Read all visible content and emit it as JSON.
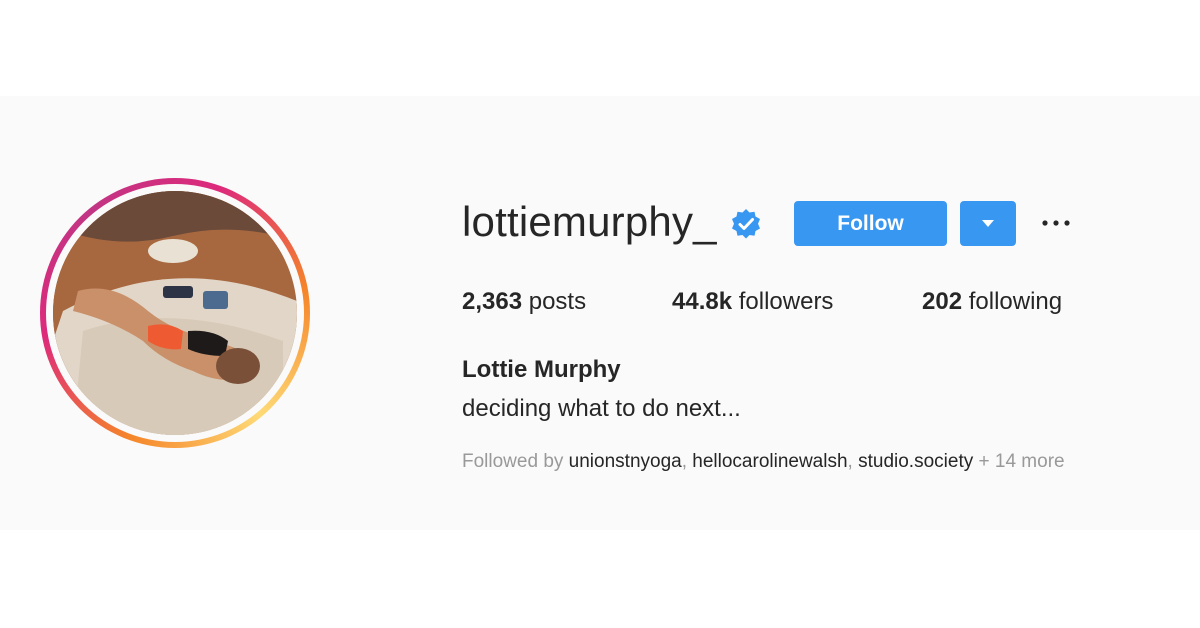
{
  "profile": {
    "username": "lottiemurphy_",
    "verified": true,
    "full_name": "Lottie Murphy",
    "bio": "deciding what to do next...",
    "follow_label": "Follow"
  },
  "stats": {
    "posts_count": "2,363",
    "posts_label": "posts",
    "followers_count": "44.8k",
    "followers_label": "followers",
    "following_count": "202",
    "following_label": "following"
  },
  "followed_by": {
    "prefix": "Followed by",
    "accounts": [
      "unionstnyoga",
      "hellocarolinewalsh",
      "studio.society"
    ],
    "more": "+ 14 more"
  },
  "colors": {
    "accent": "#3897f0",
    "verified_badge": "#3897f0",
    "text": "#262626",
    "muted": "#999999",
    "band_background": "#fafafa"
  },
  "icons": {
    "verified": "verified-badge-icon",
    "dropdown": "caret-down-icon",
    "more": "more-options-icon"
  }
}
